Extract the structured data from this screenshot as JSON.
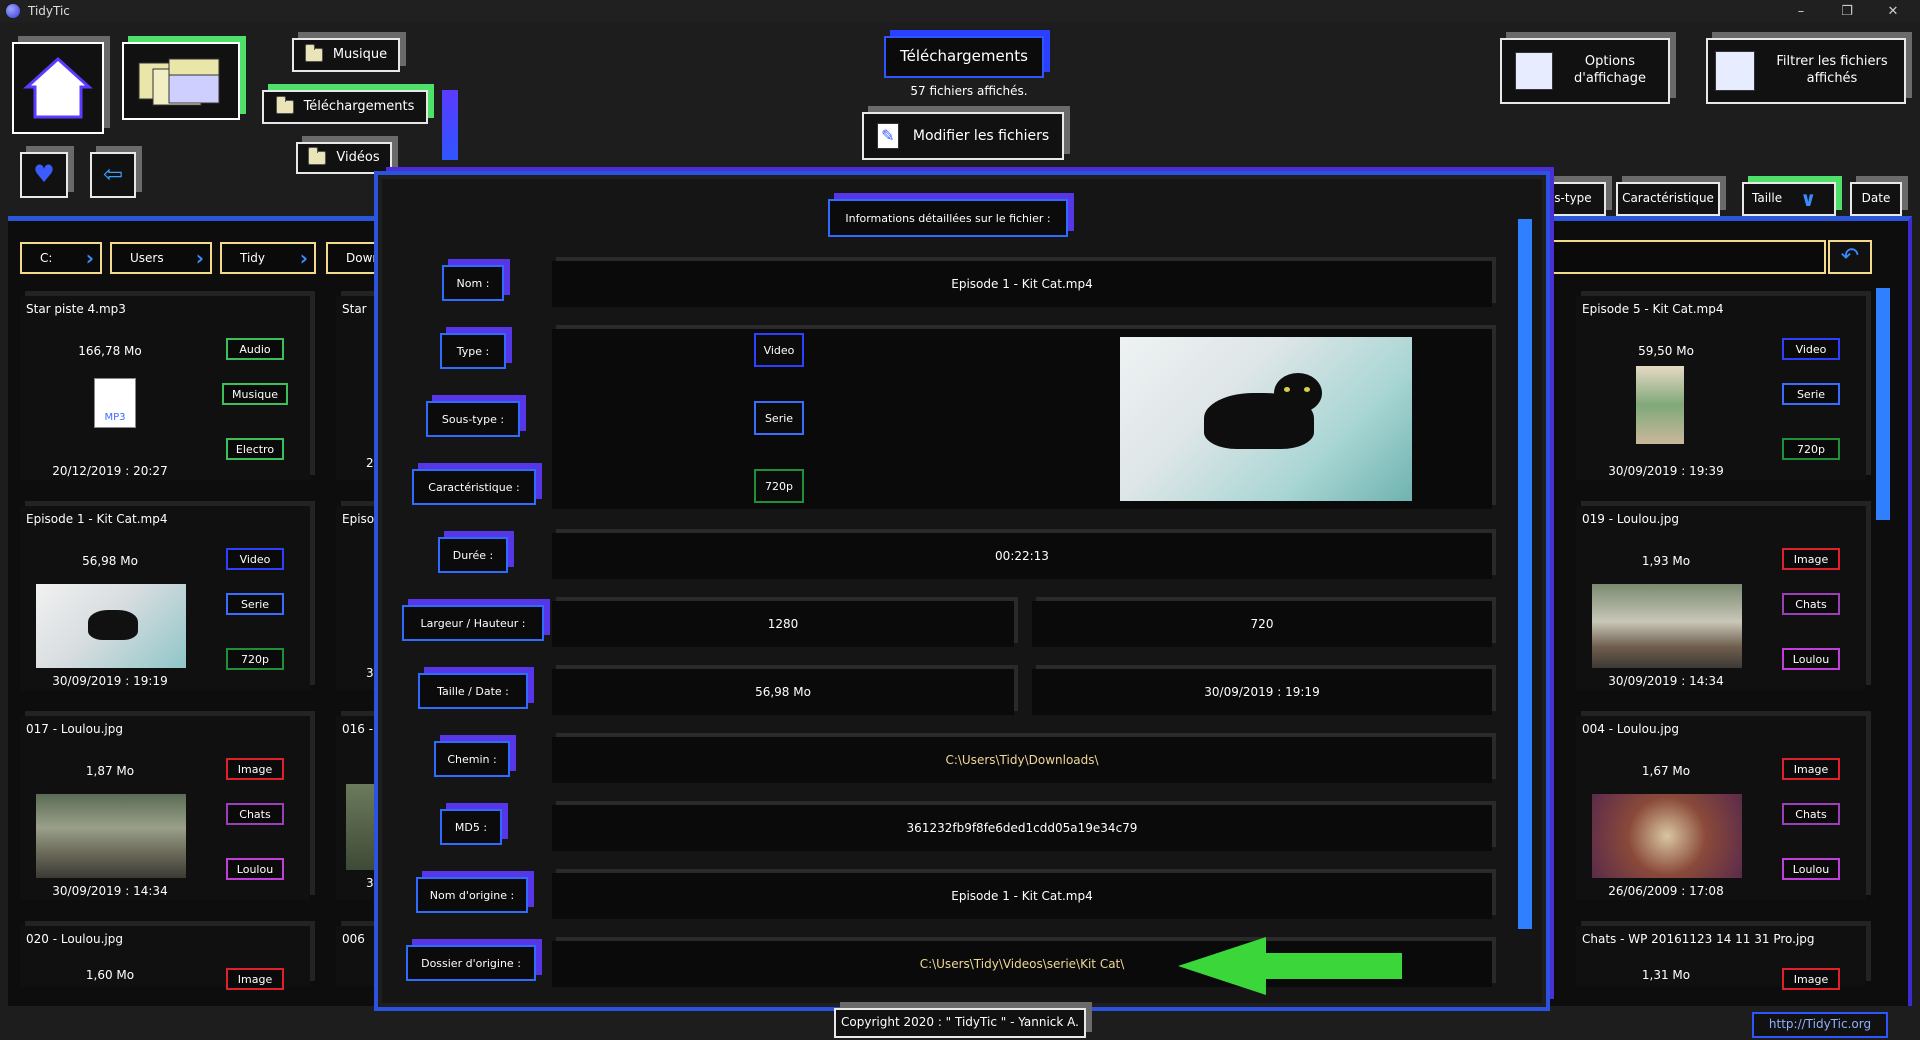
{
  "window": {
    "title": "TidyTic",
    "minimize": "–",
    "restore": "❐",
    "close": "✕"
  },
  "nav": {
    "musique": "Musique",
    "telechargements_btn": "Téléchargements",
    "videos": "Vidéos"
  },
  "header": {
    "title": "Téléchargements",
    "count": "57 fichiers affichés.",
    "modify": "Modifier les fichiers"
  },
  "options": {
    "display": "Options d'affichage",
    "filter": "Filtrer les fichiers affichés"
  },
  "sort": {
    "subtype": "s-type",
    "characteristic": "Caractéristique",
    "size": "Taille",
    "date": "Date"
  },
  "path": [
    "C:",
    "Users",
    "Tidy",
    "Down"
  ],
  "left_cards": [
    {
      "name": "Star piste 4.mp3",
      "size": "166,78 Mo",
      "date": "20/12/2019 : 20:27",
      "tags": [
        "Audio",
        "Musique",
        "Electro"
      ]
    },
    {
      "name": "Episode 1 - Kit Cat.mp4",
      "size": "56,98 Mo",
      "date": "30/09/2019 : 19:19",
      "tags": [
        "Video",
        "Serie",
        "720p"
      ]
    },
    {
      "name": "017 - Loulou.jpg",
      "size": "1,87 Mo",
      "date": "30/09/2019 : 14:34",
      "tags": [
        "Image",
        "Chats",
        "Loulou"
      ]
    },
    {
      "name": "020 - Loulou.jpg",
      "size": "1,60 Mo",
      "date": "",
      "tags": [
        "Image"
      ]
    }
  ],
  "mid_cards": [
    {
      "name": "Star",
      "date": "2"
    },
    {
      "name": "Episo",
      "date": "3"
    },
    {
      "name": "016 -",
      "date": "3"
    },
    {
      "name": "006",
      "date": ""
    }
  ],
  "right_cards": [
    {
      "name": "Episode 5 - Kit Cat.mp4",
      "size": "59,50 Mo",
      "date": "30/09/2019 : 19:39",
      "tags": [
        "Video",
        "Serie",
        "720p"
      ]
    },
    {
      "name": "019 - Loulou.jpg",
      "size": "1,93 Mo",
      "date": "30/09/2019 : 14:34",
      "tags": [
        "Image",
        "Chats",
        "Loulou"
      ]
    },
    {
      "name": "004 - Loulou.jpg",
      "size": "1,67 Mo",
      "date": "26/06/2009 : 17:08",
      "tags": [
        "Image",
        "Chats",
        "Loulou"
      ]
    },
    {
      "name": "Chats - WP  20161123  14 11 31 Pro.jpg",
      "size": "1,31 Mo",
      "date": "",
      "tags": [
        "Image"
      ]
    }
  ],
  "tag_colors": {
    "Audio": "#3cbf5a",
    "Musique": "#3cbf5a",
    "Electro": "#3cbf5a",
    "Video": "#2f3fff",
    "Serie": "#3a6cff",
    "720p": "#1f8f3a",
    "Image": "#e0202a",
    "Chats": "#9b3fb8",
    "Loulou": "#c03fd8"
  },
  "modal": {
    "title": "Informations détaillées sur le fichier :",
    "labels": {
      "nom": "Nom :",
      "type": "Type :",
      "soustype": "Sous-type :",
      "carac": "Caractéristique :",
      "duree": "Durée :",
      "dims": "Largeur / Hauteur :",
      "taille": "Taille / Date :",
      "chemin": "Chemin :",
      "md5": "MD5 :",
      "nom_origine": "Nom d'origine :",
      "dossier_origine": "Dossier d'origine :"
    },
    "values": {
      "nom": "Episode 1 - Kit Cat.mp4",
      "type": "Video",
      "soustype": "Serie",
      "carac": "720p",
      "duree": "00:22:13",
      "largeur": "1280",
      "hauteur": "720",
      "taille": "56,98 Mo",
      "date": "30/09/2019 : 19:19",
      "chemin": "C:\\Users\\Tidy\\Downloads\\",
      "md5": "361232fb9f8fe6ded1cdd05a19e34c79",
      "nom_origine": "Episode 1 - Kit Cat.mp4",
      "dossier_origine": "C:\\Users\\Tidy\\Videos\\serie\\Kit Cat\\"
    }
  },
  "footer": {
    "copyright": "Copyright 2020 : \" TidyTic \" - Yannick A.",
    "url": "http://TidyTic.org"
  }
}
